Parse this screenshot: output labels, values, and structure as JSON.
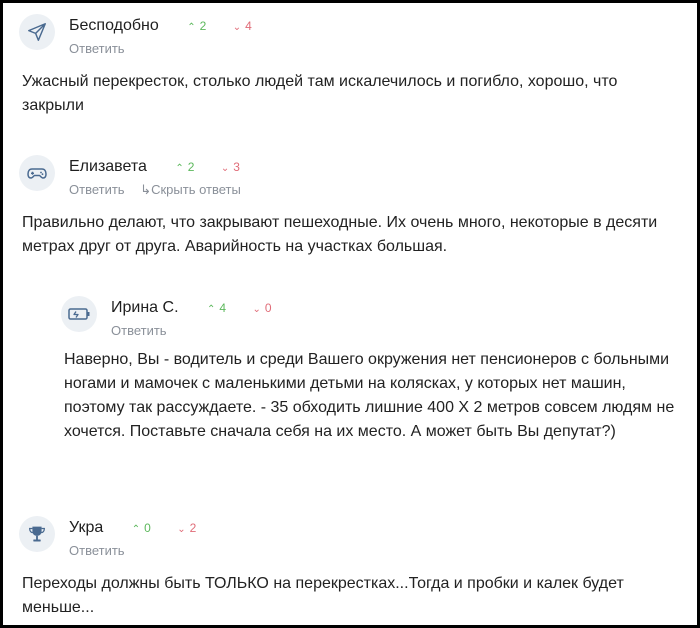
{
  "comments": [
    {
      "author": "Бесподобно",
      "avatar_icon": "paper-plane-icon",
      "upvotes": "2",
      "downvotes": "4",
      "reply_label": "Ответить",
      "text": "Ужасный перекресток, столько людей там искалечилось и погибло, хорошо, что закрыли"
    },
    {
      "author": "Елизавета",
      "avatar_icon": "gamepad-icon",
      "upvotes": "2",
      "downvotes": "3",
      "reply_label": "Ответить",
      "hide_replies_label": "Скрыть ответы",
      "text": "Правильно делают, что закрывают пешеходные. Их очень много, некоторые в десяти метрах друг от друга. Аварийность на участках большая."
    },
    {
      "author": "Ирина С.",
      "avatar_icon": "battery-icon",
      "upvotes": "4",
      "downvotes": "0",
      "reply_label": "Ответить",
      "text": "Наверно, Вы - водитель и среди Вашего окружения нет пенсионеров с больными ногами и мамочек с маленькими детьми на колясках, у которых нет машин, поэтому так рассуждаете. - 35 обходить лишние 400 Х 2 метров совсем людям не хочется. Поставьте сначала себя на их место. А может быть Вы депутат?)"
    },
    {
      "author": "Укра",
      "avatar_icon": "trophy-icon",
      "upvotes": "0",
      "downvotes": "2",
      "reply_label": "Ответить",
      "text": "Переходы должны быть ТОЛЬКО на перекрестках...Тогда и пробки и калек будет меньше..."
    }
  ],
  "colors": {
    "upvote": "#5cb85c",
    "downvote": "#e06c78",
    "muted": "#8a9099",
    "avatar_bg": "#ecf0f4",
    "icon": "#4a6a90"
  }
}
